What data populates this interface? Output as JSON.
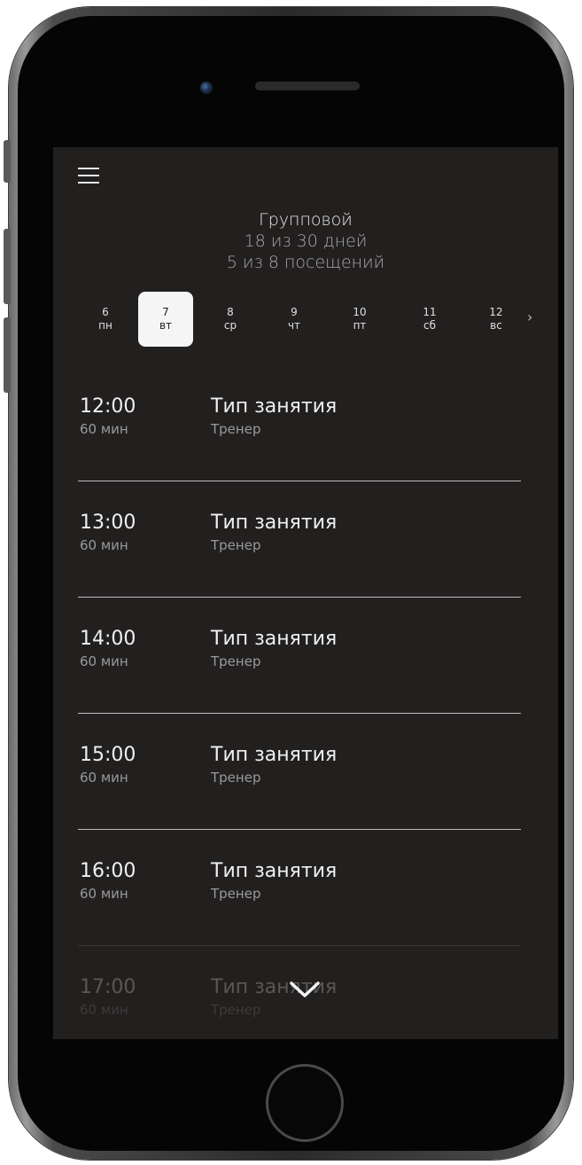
{
  "header": {
    "title": "Групповой",
    "days_progress": "18 из 30 дней",
    "visits_progress": "5 из 8 посещений"
  },
  "days": [
    {
      "num": "6",
      "weekday": "пн",
      "selected": false
    },
    {
      "num": "7",
      "weekday": "вт",
      "selected": true
    },
    {
      "num": "8",
      "weekday": "ср",
      "selected": false
    },
    {
      "num": "9",
      "weekday": "чт",
      "selected": false
    },
    {
      "num": "10",
      "weekday": "пт",
      "selected": false
    },
    {
      "num": "11",
      "weekday": "сб",
      "selected": false
    },
    {
      "num": "12",
      "weekday": "вс",
      "selected": false
    }
  ],
  "day_arrow": "›",
  "sessions": [
    {
      "time": "12:00",
      "duration": "60 мин",
      "type": "Тип занятия",
      "trainer": "Тренер"
    },
    {
      "time": "13:00",
      "duration": "60 мин",
      "type": "Тип занятия",
      "trainer": "Тренер"
    },
    {
      "time": "14:00",
      "duration": "60 мин",
      "type": "Тип занятия",
      "trainer": "Тренер"
    },
    {
      "time": "15:00",
      "duration": "60 мин",
      "type": "Тип занятия",
      "trainer": "Тренер"
    },
    {
      "time": "16:00",
      "duration": "60 мин",
      "type": "Тип занятия",
      "trainer": "Тренер"
    },
    {
      "time": "17:00",
      "duration": "60 мин",
      "type": "Тип занятия",
      "trainer": "Тренер"
    }
  ],
  "icons": {
    "menu": "hamburger-menu-icon",
    "scroll": "chevron-down-icon",
    "next": "chevron-right-icon"
  },
  "colors": {
    "screen_bg": "#221f1f",
    "selected_day_bg": "#f5f5f5",
    "text_primary": "#f0f0f0",
    "text_secondary": "#9a9a9a",
    "divider": "#bdbdbd"
  }
}
